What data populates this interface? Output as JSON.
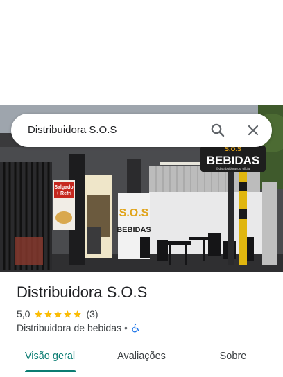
{
  "search": {
    "query": "Distribuidora S.O.S"
  },
  "photo": {
    "sign_top": "S.O.S",
    "sign_main": "BEBIDAS",
    "sign_handle": "@distribuidorasos_oficial",
    "wall_logo_top": "S.O.S",
    "wall_logo_main": "BEBIDAS",
    "banner_line1": "Salgado",
    "banner_line2": "+ Refri"
  },
  "place": {
    "name": "Distribuidora S.O.S",
    "rating": "5,0",
    "review_count": "(3)",
    "stars": 5,
    "category": "Distribuidora de bebidas",
    "separator": "•"
  },
  "tabs": [
    {
      "label": "Visão geral",
      "active": true
    },
    {
      "label": "Avaliações",
      "active": false
    },
    {
      "label": "Sobre",
      "active": false
    }
  ],
  "colors": {
    "accent": "#0b7d73",
    "star": "#fbbc04",
    "accessibility": "#1a73e8"
  }
}
